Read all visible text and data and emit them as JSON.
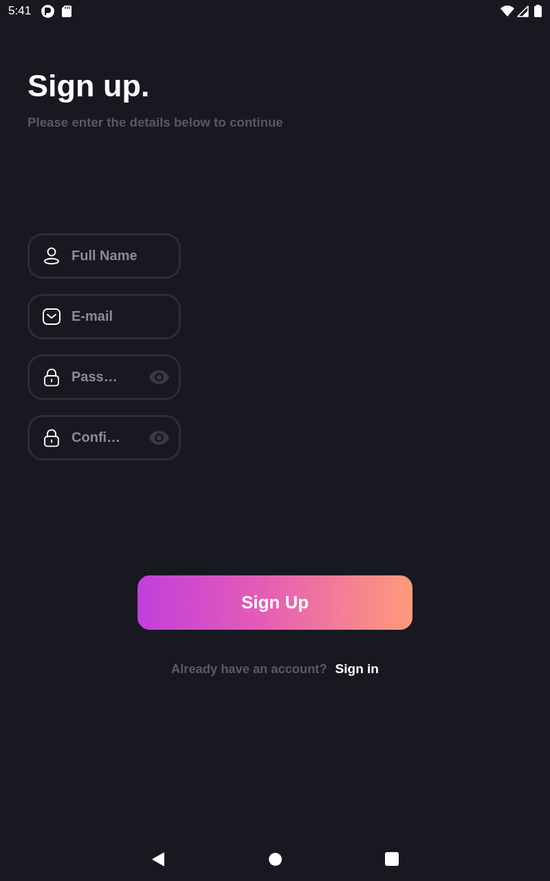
{
  "status_bar": {
    "time": "5:41"
  },
  "header": {
    "title": "Sign up.",
    "subtitle": "Please enter the details below to continue"
  },
  "fields": [
    {
      "kind": "name",
      "placeholder": "Full Name"
    },
    {
      "kind": "email",
      "placeholder": "E-mail"
    },
    {
      "kind": "password",
      "placeholder": "Pass…"
    },
    {
      "kind": "password",
      "placeholder": "Confi…"
    }
  ],
  "submit": {
    "label": "Sign Up"
  },
  "footer": {
    "prompt": "Already have an account?",
    "link": "Sign in"
  }
}
